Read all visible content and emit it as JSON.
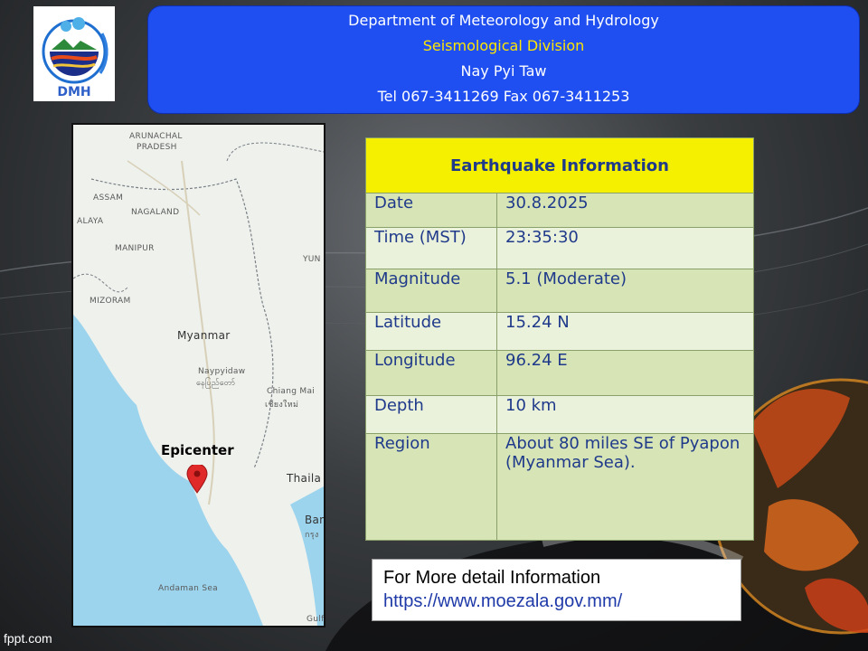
{
  "header": {
    "line1": "Department of Meteorology and Hydrology",
    "line2": "Seismological Division",
    "line3": "Nay Pyi Taw",
    "line4": "Tel 067-3411269 Fax 067-3411253"
  },
  "logo": {
    "text": "DMH"
  },
  "map": {
    "labels": [
      "ARUNACHAL",
      "PRADESH",
      "ASSAM",
      "NAGALAND",
      "ALAYA",
      "MANIPUR",
      "MIZORAM",
      "YUN",
      "Myanmar",
      "Naypyidaw",
      "နေပြည်တော်",
      "Chiang Mai",
      "เชียงใหม่",
      "Thaila",
      "Ban",
      "กรุง",
      "Andaman Sea",
      "Gulf"
    ],
    "epicenter_label": "Epicenter"
  },
  "earthquake": {
    "title": "Earthquake Information",
    "rows": [
      {
        "label": "Date",
        "value": "30.8.2025"
      },
      {
        "label": "Time (MST)",
        "value": "23:35:30"
      },
      {
        "label": "Magnitude",
        "value": "5.1 (Moderate)"
      },
      {
        "label": "Latitude",
        "value": "15.24 N"
      },
      {
        "label": "Longitude",
        "value": "96.24 E"
      },
      {
        "label": "Depth",
        "value": "10 km"
      },
      {
        "label": "Region",
        "value": "About 80 miles SE of Pyapon (Myanmar Sea)."
      }
    ]
  },
  "more_info": {
    "line1": "For More detail Information",
    "line2": "https://www.moezala.gov.mm/"
  },
  "footer": {
    "watermark": "fppt.com"
  },
  "colors": {
    "header_bg": "#1f4ff0",
    "title_bg": "#f4f000",
    "row_alt": "#d7e4b6",
    "row_plain": "#ebf2dc",
    "epicenter_pin": "#e02a2a"
  }
}
